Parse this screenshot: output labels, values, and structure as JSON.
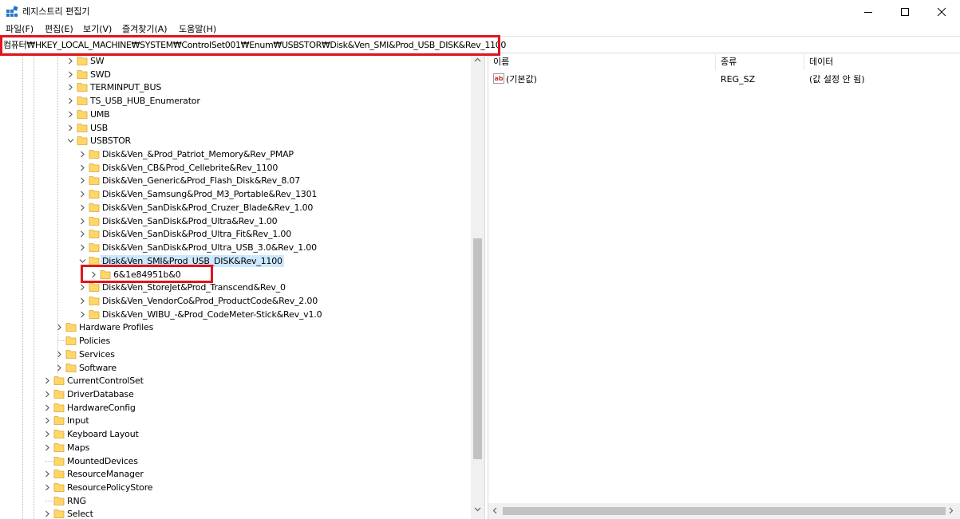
{
  "window": {
    "title": "레지스트리 편집기"
  },
  "menu": [
    "파일(F)",
    "편집(E)",
    "보기(V)",
    "즐겨찾기(A)",
    "도움말(H)"
  ],
  "address": {
    "path": "컴퓨터₩HKEY_LOCAL_MACHINE₩SYSTEM₩ControlSet001₩Enum₩USBSTOR₩Disk&Ven_SMI&Prod_USB_DISK&Rev_1100"
  },
  "tree": [
    {
      "label": "SW"
    },
    {
      "label": "SWD"
    },
    {
      "label": "TERMINPUT_BUS"
    },
    {
      "label": "TS_USB_HUB_Enumerator"
    },
    {
      "label": "UMB"
    },
    {
      "label": "USB"
    },
    {
      "label": "USBSTOR"
    },
    {
      "label": "Disk&Ven_&Prod_Patriot_Memory&Rev_PMAP"
    },
    {
      "label": "Disk&Ven_CB&Prod_Cellebrite&Rev_1100"
    },
    {
      "label": "Disk&Ven_Generic&Prod_Flash_Disk&Rev_8.07"
    },
    {
      "label": "Disk&Ven_Samsung&Prod_M3_Portable&Rev_1301"
    },
    {
      "label": "Disk&Ven_SanDisk&Prod_Cruzer_Blade&Rev_1.00"
    },
    {
      "label": "Disk&Ven_SanDisk&Prod_Ultra&Rev_1.00"
    },
    {
      "label": "Disk&Ven_SanDisk&Prod_Ultra_Fit&Rev_1.00"
    },
    {
      "label": "Disk&Ven_SanDisk&Prod_Ultra_USB_3.0&Rev_1.00"
    },
    {
      "label": "Disk&Ven_SMI&Prod_USB_DISK&Rev_1100"
    },
    {
      "label": "6&1e84951b&0"
    },
    {
      "label": "Disk&Ven_StoreJet&Prod_Transcend&Rev_0"
    },
    {
      "label": "Disk&Ven_VendorCo&Prod_ProductCode&Rev_2.00"
    },
    {
      "label": "Disk&Ven_WIBU_-&Prod_CodeMeter-Stick&Rev_v1.0"
    },
    {
      "label": "Hardware Profiles"
    },
    {
      "label": "Policies"
    },
    {
      "label": "Services"
    },
    {
      "label": "Software"
    },
    {
      "label": "CurrentControlSet"
    },
    {
      "label": "DriverDatabase"
    },
    {
      "label": "HardwareConfig"
    },
    {
      "label": "Input"
    },
    {
      "label": "Keyboard Layout"
    },
    {
      "label": "Maps"
    },
    {
      "label": "MountedDevices"
    },
    {
      "label": "ResourceManager"
    },
    {
      "label": "ResourcePolicyStore"
    },
    {
      "label": "RNG"
    },
    {
      "label": "Select"
    }
  ],
  "values_pane": {
    "columns": {
      "name": "이름",
      "type": "종류",
      "data": "데이터"
    },
    "rows": [
      {
        "name": "(기본값)",
        "type": "REG_SZ",
        "data": "(값 설정 안 됨)"
      }
    ]
  },
  "colors": {
    "highlight_box": "#e0151d",
    "selection": "#cce8ff",
    "folder": "#ffd766"
  },
  "icons": [
    "registry-editor-icon",
    "minimize-icon",
    "maximize-icon",
    "close-icon",
    "folder-icon",
    "chevron-right-icon",
    "chevron-down-icon",
    "string-value-icon"
  ]
}
